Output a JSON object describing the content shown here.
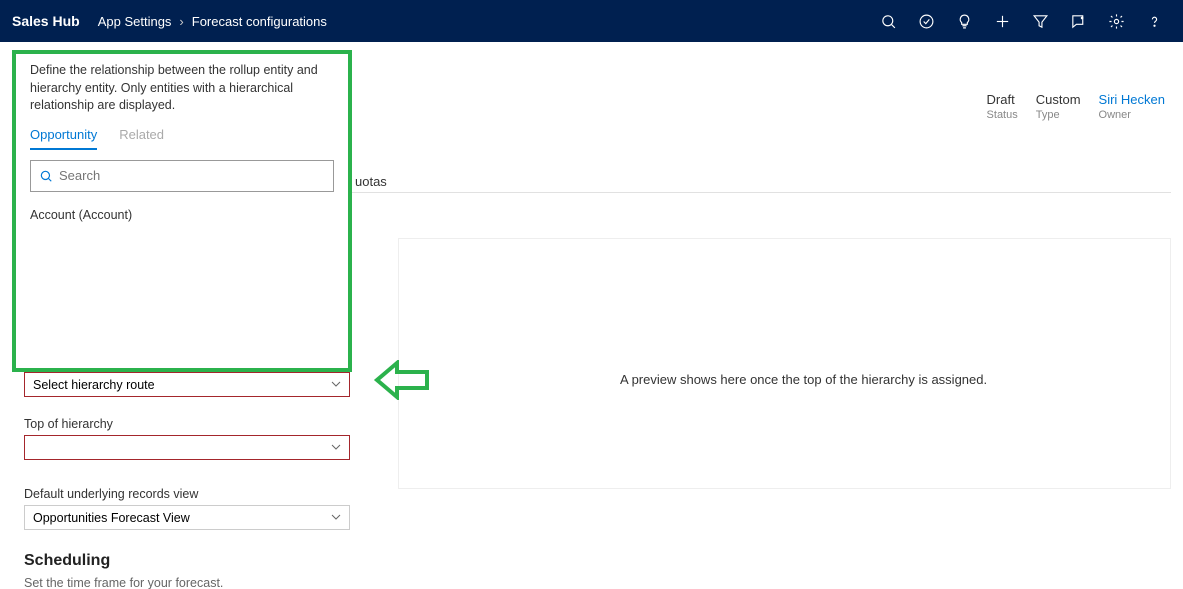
{
  "header": {
    "app_title": "Sales Hub",
    "breadcrumb": [
      "App Settings",
      "Forecast configurations"
    ]
  },
  "meta": {
    "status": {
      "value": "Draft",
      "label": "Status"
    },
    "type": {
      "value": "Custom",
      "label": "Type"
    },
    "owner": {
      "value": "Siri Hecken",
      "label": "Owner"
    }
  },
  "tabs_remnant": "uotas",
  "popup": {
    "description": "Define the relationship between the rollup entity and hierarchy entity. Only entities with a hierarchical relationship are displayed.",
    "tabs": {
      "active": "Opportunity",
      "inactive": "Related"
    },
    "search_placeholder": "Search",
    "results": [
      "Account (Account)"
    ]
  },
  "fields": {
    "hierarchy_route": {
      "value": "Select hierarchy route"
    },
    "top_label": "Top of hierarchy",
    "top_value": "",
    "view_label": "Default underlying records view",
    "view_value": "Opportunities Forecast View"
  },
  "preview_text": "A preview shows here once the top of the hierarchy is assigned.",
  "scheduling": {
    "title": "Scheduling",
    "subtitle": "Set the time frame for your forecast."
  }
}
